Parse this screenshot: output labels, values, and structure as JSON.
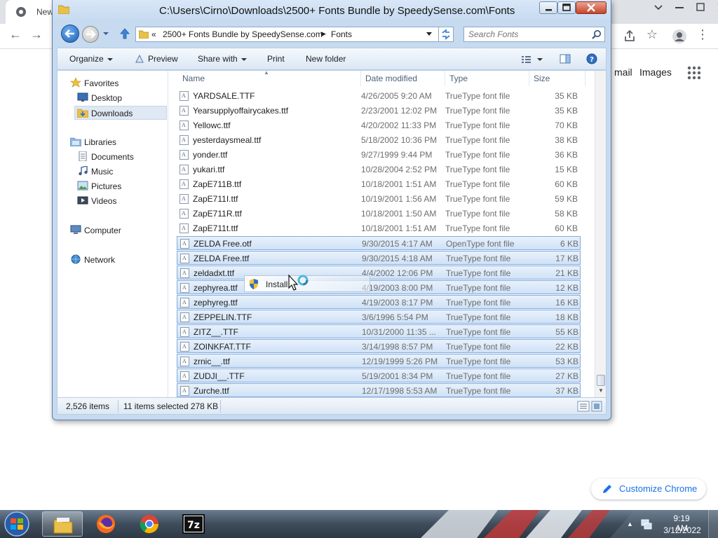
{
  "chrome": {
    "tab_title": "New",
    "gmail_link": "mail",
    "images_link": "Images",
    "customize_label": "Customize Chrome"
  },
  "window": {
    "title": "C:\\Users\\Cirno\\Downloads\\2500+ Fonts Bundle by SpeedySense.com\\Fonts"
  },
  "address": {
    "overflow": "«",
    "crumbs": [
      "2500+ Fonts Bundle by SpeedySense.com",
      "Fonts"
    ]
  },
  "search": {
    "placeholder": "Search Fonts"
  },
  "toolbar": {
    "organize": "Organize",
    "preview": "Preview",
    "share_with": "Share with",
    "print": "Print",
    "new_folder": "New folder"
  },
  "nav": {
    "favorites": "Favorites",
    "desktop": "Desktop",
    "downloads": "Downloads",
    "libraries": "Libraries",
    "documents": "Documents",
    "music": "Music",
    "pictures": "Pictures",
    "videos": "Videos",
    "computer": "Computer",
    "network": "Network"
  },
  "columns": {
    "name": "Name",
    "date_modified": "Date modified",
    "type": "Type",
    "size": "Size"
  },
  "files": [
    {
      "name": "YARDSALE.TTF",
      "date": "4/26/2005 9:20 AM",
      "type": "TrueType font file",
      "size": "35 KB",
      "selected": false
    },
    {
      "name": "Yearsupplyoffairycakes.ttf",
      "date": "2/23/2001 12:02 PM",
      "type": "TrueType font file",
      "size": "35 KB",
      "selected": false
    },
    {
      "name": "Yellowc.ttf",
      "date": "4/20/2002 11:33 PM",
      "type": "TrueType font file",
      "size": "70 KB",
      "selected": false
    },
    {
      "name": "yesterdaysmeal.ttf",
      "date": "5/18/2002 10:36 PM",
      "type": "TrueType font file",
      "size": "38 KB",
      "selected": false
    },
    {
      "name": "yonder.ttf",
      "date": "9/27/1999 9:44 PM",
      "type": "TrueType font file",
      "size": "36 KB",
      "selected": false
    },
    {
      "name": "yukari.ttf",
      "date": "10/28/2004 2:52 PM",
      "type": "TrueType font file",
      "size": "15 KB",
      "selected": false
    },
    {
      "name": "ZapE711B.ttf",
      "date": "10/18/2001 1:51 AM",
      "type": "TrueType font file",
      "size": "60 KB",
      "selected": false
    },
    {
      "name": "ZapE711I.ttf",
      "date": "10/19/2001 1:56 AM",
      "type": "TrueType font file",
      "size": "59 KB",
      "selected": false
    },
    {
      "name": "ZapE711R.ttf",
      "date": "10/18/2001 1:50 AM",
      "type": "TrueType font file",
      "size": "58 KB",
      "selected": false
    },
    {
      "name": "ZapE711t.ttf",
      "date": "10/18/2001 1:51 AM",
      "type": "TrueType font file",
      "size": "60 KB",
      "selected": false
    },
    {
      "name": "ZELDA Free.otf",
      "date": "9/30/2015 4:17 AM",
      "type": "OpenType font file",
      "size": "6 KB",
      "selected": true
    },
    {
      "name": "ZELDA Free.ttf",
      "date": "9/30/2015 4:18 AM",
      "type": "TrueType font file",
      "size": "17 KB",
      "selected": true
    },
    {
      "name": "zeldadxt.ttf",
      "date": "4/4/2002 12:06 PM",
      "type": "TrueType font file",
      "size": "21 KB",
      "selected": true
    },
    {
      "name": "zephyrea.ttf",
      "date": "4/19/2003 8:00 PM",
      "type": "TrueType font file",
      "size": "12 KB",
      "selected": true
    },
    {
      "name": "zephyreg.ttf",
      "date": "4/19/2003 8:17 PM",
      "type": "TrueType font file",
      "size": "16 KB",
      "selected": true
    },
    {
      "name": "ZEPPELIN.TTF",
      "date": "3/6/1996 5:54 PM",
      "type": "TrueType font file",
      "size": "18 KB",
      "selected": true
    },
    {
      "name": "ZITZ__.TTF",
      "date": "10/31/2000 11:35 ...",
      "type": "TrueType font file",
      "size": "55 KB",
      "selected": true
    },
    {
      "name": "ZOINKFAT.TTF",
      "date": "3/14/1998 8:57 PM",
      "type": "TrueType font file",
      "size": "22 KB",
      "selected": true
    },
    {
      "name": "zrnic__.ttf",
      "date": "12/19/1999 5:26 PM",
      "type": "TrueType font file",
      "size": "53 KB",
      "selected": true
    },
    {
      "name": "ZUDJI__.TTF",
      "date": "5/19/2001 8:34 PM",
      "type": "TrueType font file",
      "size": "27 KB",
      "selected": true
    },
    {
      "name": "Zurche.ttf",
      "date": "12/17/1998 5:53 AM",
      "type": "TrueType font file",
      "size": "37 KB",
      "selected": true
    }
  ],
  "drag_tooltip": {
    "label": "Install"
  },
  "status": {
    "count": "2,526 items",
    "selected": "11 items selected  278 KB"
  },
  "taskbar": {
    "apps": [
      "file-explorer",
      "firefox",
      "chrome",
      "7-zip"
    ],
    "app_7zip_label": "7z",
    "time": "9:19 AM",
    "date": "3/12/2022"
  },
  "colors": {
    "selection_fill": "#cfe2f7",
    "selection_border": "#84acdd",
    "chrome_accent": "#1a73e8"
  }
}
